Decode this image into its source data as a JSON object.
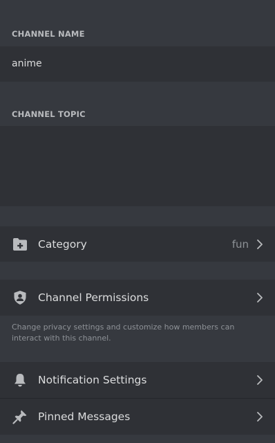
{
  "channel_name": {
    "label": "CHANNEL NAME",
    "value": "anime"
  },
  "channel_topic": {
    "label": "CHANNEL TOPIC",
    "value": ""
  },
  "category": {
    "label": "Category",
    "value": "fun",
    "icon": "folder-plus-icon"
  },
  "permissions": {
    "label": "Channel Permissions",
    "icon": "shield-user-icon",
    "hint": "Change privacy settings and customize how members can interact with this channel."
  },
  "notifications": {
    "label": "Notification Settings",
    "icon": "bell-icon"
  },
  "pinned": {
    "label": "Pinned Messages",
    "icon": "pin-icon"
  },
  "colors": {
    "background": "#36393f",
    "row": "#2f3136",
    "text": "#dcddde",
    "muted": "#8e9297",
    "icon": "#b9bbbe"
  }
}
